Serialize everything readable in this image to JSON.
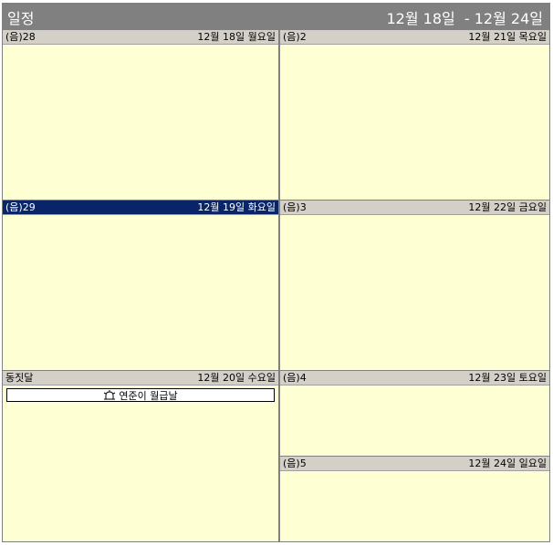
{
  "header": {
    "title": "일정",
    "range": "12월 18일  - 12월 24일"
  },
  "days": [
    {
      "lunar": "(음)28",
      "date": "12월 18일 월요일"
    },
    {
      "lunar": "(음)29",
      "date": "12월 19일 화요일"
    },
    {
      "lunar": "동짓달",
      "date": "12월 20일 수요일",
      "event": "연준이 월급날"
    },
    {
      "lunar": "(음)2",
      "date": "12월 21일 목요일"
    },
    {
      "lunar": "(음)3",
      "date": "12월 22일 금요일"
    },
    {
      "lunar": "(음)4",
      "date": "12월 23일 토요일"
    },
    {
      "lunar": "(음)5",
      "date": "12월 24일 일요일"
    }
  ],
  "colors": {
    "title_bar": "#808080",
    "day_background": "#ffffd4",
    "day_header": "#d4d0c8",
    "selected_header": "#0a246a"
  },
  "selected_day": "12월 19일 화요일",
  "event_icon": "alarm-bell-icon"
}
